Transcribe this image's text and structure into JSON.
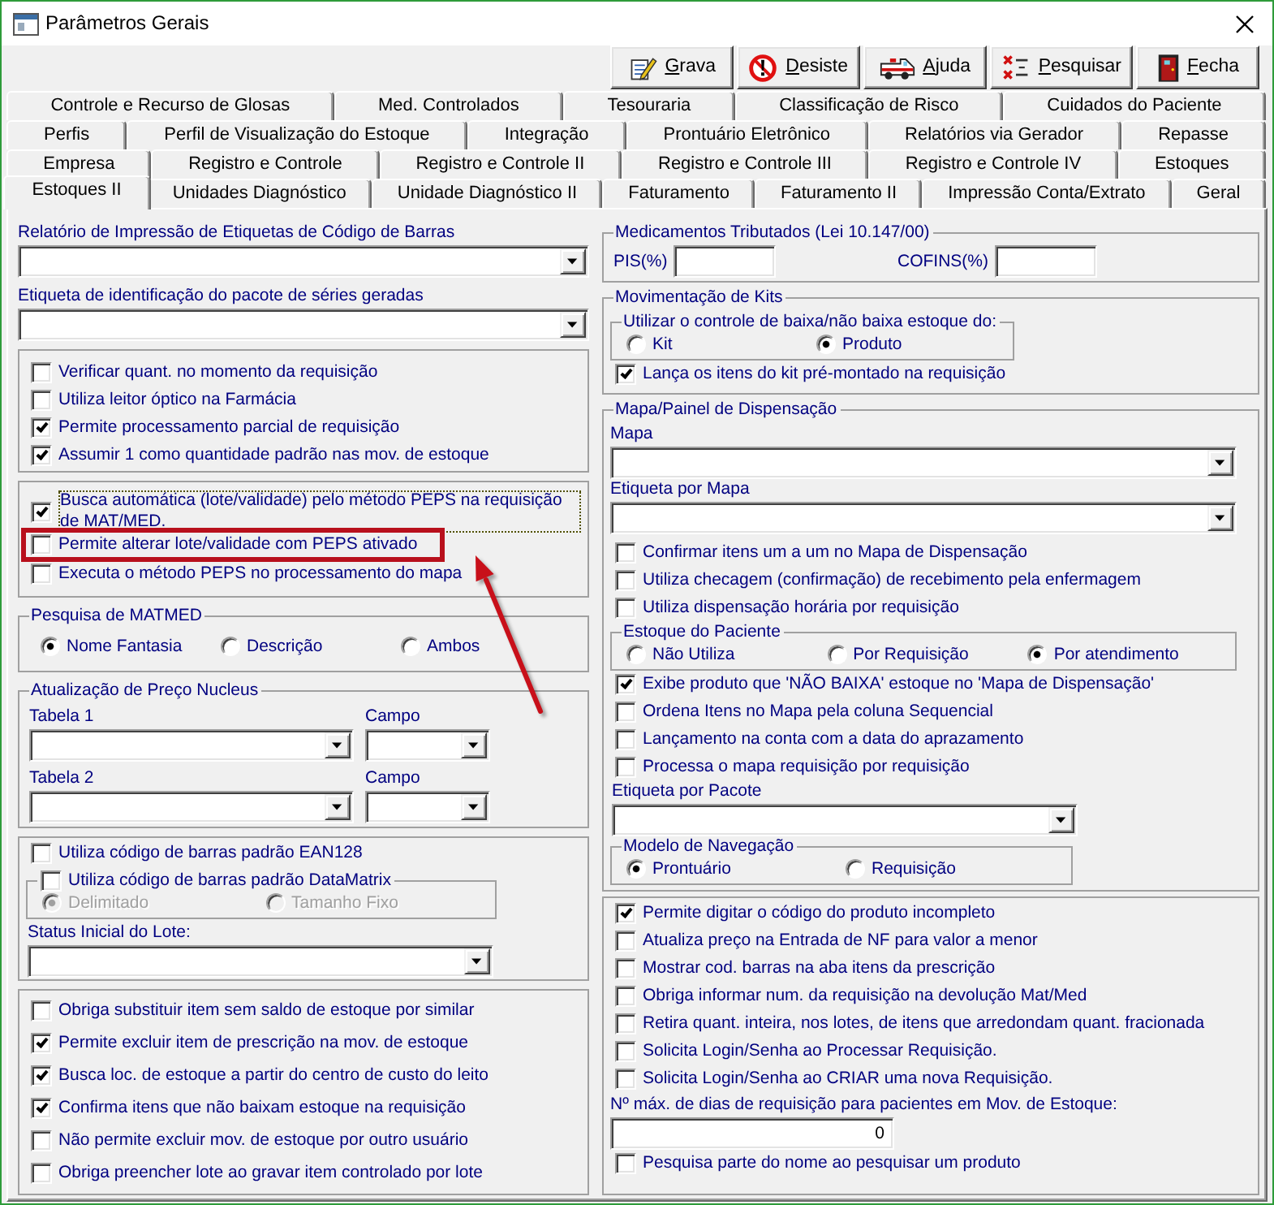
{
  "window": {
    "title": "Parâmetros Gerais"
  },
  "toolbar": [
    {
      "label": "Grava",
      "kind": "save"
    },
    {
      "label": "Desiste",
      "kind": "cancel"
    },
    {
      "label": "Ajuda",
      "kind": "help"
    },
    {
      "label": "Pesquisar",
      "kind": "search"
    },
    {
      "label": "Fecha",
      "kind": "exit"
    }
  ],
  "tab_rows": [
    [
      {
        "label": "Controle e Recurso de Glosas",
        "selected": false
      },
      {
        "label": "Med. Controlados",
        "selected": false
      },
      {
        "label": "Tesouraria",
        "selected": false
      },
      {
        "label": "Classificação de Risco",
        "selected": false
      },
      {
        "label": "Cuidados do Paciente",
        "selected": false
      }
    ],
    [
      {
        "label": "Perfis",
        "selected": false
      },
      {
        "label": "Perfil de Visualização do Estoque",
        "selected": false
      },
      {
        "label": "Integração",
        "selected": false
      },
      {
        "label": "Prontuário Eletrônico",
        "selected": false
      },
      {
        "label": "Relatórios via Gerador",
        "selected": false
      },
      {
        "label": "Repasse",
        "selected": false
      }
    ],
    [
      {
        "label": "Empresa",
        "selected": false
      },
      {
        "label": "Registro e Controle",
        "selected": false
      },
      {
        "label": "Registro e Controle II",
        "selected": false
      },
      {
        "label": "Registro e Controle III",
        "selected": false
      },
      {
        "label": "Registro e Controle IV",
        "selected": false
      },
      {
        "label": "Estoques",
        "selected": false
      }
    ],
    [
      {
        "label": "Estoques II",
        "selected": true
      },
      {
        "label": "Unidades Diagnóstico",
        "selected": false
      },
      {
        "label": "Unidade Diagnóstico II",
        "selected": false
      },
      {
        "label": "Faturamento",
        "selected": false
      },
      {
        "label": "Faturamento II",
        "selected": false
      },
      {
        "label": "Impressão Conta/Extrato",
        "selected": false
      },
      {
        "label": "Geral",
        "selected": false
      }
    ]
  ],
  "left_column": [
    {
      "kind": "combo",
      "label": "Relatório de Impressão de Etiquetas de Código de Barras"
    },
    {
      "kind": "combo",
      "label": "Etiqueta de identificação do pacote de séries geradas"
    },
    {
      "kind": "group",
      "items": [
        {
          "kind": "checkbox",
          "label": "Verificar quant. no momento da requisição",
          "checked": false
        },
        {
          "kind": "checkbox",
          "label": "Utiliza leitor óptico na Farmácia",
          "checked": false
        },
        {
          "kind": "checkbox",
          "label": "Permite processamento parcial de requisição",
          "checked": true
        },
        {
          "kind": "checkbox",
          "label": "Assumir 1 como quantidade padrão nas mov. de estoque",
          "checked": true
        }
      ]
    },
    {
      "kind": "group",
      "items": [
        {
          "kind": "checkbox",
          "label": "Busca automática (lote/validade) pelo método PEPS na requisição de MAT/MED.",
          "checked": true,
          "focused": true,
          "highlighted": false
        },
        {
          "kind": "checkbox",
          "label": "Permite alterar lote/validade com PEPS ativado",
          "checked": false,
          "focused": false,
          "highlighted": true
        },
        {
          "kind": "checkbox",
          "label": "Executa o método PEPS no processamento do mapa",
          "checked": false,
          "focused": false,
          "highlighted": false
        }
      ]
    },
    {
      "kind": "group",
      "title": "Pesquisa de MATMED",
      "items": [
        {
          "kind": "radios",
          "options": [
            {
              "label": "Nome Fantasia",
              "selected": true
            },
            {
              "label": "Descrição",
              "selected": false
            },
            {
              "label": "Ambos",
              "selected": false
            }
          ]
        }
      ]
    },
    {
      "kind": "group",
      "title": "Atualização de Preço Nucleus",
      "items": [
        {
          "kind": "combo_row",
          "fields": [
            {
              "label": "Tabela 1"
            },
            {
              "label": "Campo"
            }
          ]
        },
        {
          "kind": "combo_row",
          "fields": [
            {
              "label": "Tabela 2"
            },
            {
              "label": "Campo"
            }
          ]
        }
      ]
    },
    {
      "kind": "group",
      "items": [
        {
          "kind": "checkbox",
          "label": "Utiliza código de barras padrão EAN128",
          "checked": false
        },
        {
          "kind": "group",
          "title_checkbox": {
            "label": "Utiliza código de barras padrão DataMatrix",
            "checked": false
          },
          "items": [
            {
              "kind": "radios",
              "options": [
                {
                  "label": "Delimitado",
                  "selected": true,
                  "disabled": true
                },
                {
                  "label": "Tamanho Fixo",
                  "selected": false,
                  "disabled": true
                }
              ]
            }
          ]
        },
        {
          "kind": "combo",
          "label": "Status Inicial do Lote:"
        }
      ]
    },
    {
      "kind": "group",
      "items": [
        {
          "kind": "checkbox",
          "label": "Obriga substituir item sem saldo de estoque por similar",
          "checked": false
        },
        {
          "kind": "checkbox",
          "label": "Permite excluir item de prescrição na mov. de estoque",
          "checked": true
        },
        {
          "kind": "checkbox",
          "label": "Busca loc. de estoque a partir do centro de custo do leito",
          "checked": true
        },
        {
          "kind": "checkbox",
          "label": "Confirma itens que não baixam estoque na requisição",
          "checked": true
        },
        {
          "kind": "checkbox",
          "label": "Não permite excluir mov. de estoque por outro usuário",
          "checked": false
        },
        {
          "kind": "checkbox",
          "label": "Obriga preencher lote ao gravar item controlado por lote",
          "checked": false
        }
      ]
    }
  ],
  "right_column": [
    {
      "kind": "group",
      "title": "Medicamentos Tributados (Lei 10.147/00)",
      "items": [
        {
          "kind": "input_row",
          "fields": [
            {
              "label": "PIS(%)"
            },
            {
              "label": "COFINS(%)"
            }
          ]
        }
      ]
    },
    {
      "kind": "group",
      "title": "Movimentação de Kits",
      "items": [
        {
          "kind": "group",
          "title": "Utilizar o controle de baixa/não baixa estoque do:",
          "items": [
            {
              "kind": "radios",
              "options": [
                {
                  "label": "Kit",
                  "selected": false
                },
                {
                  "label": "Produto",
                  "selected": true
                }
              ]
            }
          ]
        },
        {
          "kind": "checkbox",
          "label": "Lança os itens do kit pré-montado na requisição",
          "checked": true
        }
      ]
    },
    {
      "kind": "group",
      "title": "Mapa/Painel de Dispensação",
      "items": [
        {
          "kind": "combo",
          "label": "Mapa"
        },
        {
          "kind": "combo",
          "label": "Etiqueta por Mapa"
        },
        {
          "kind": "checkbox",
          "label": "Confirmar itens um a um no Mapa de Dispensação",
          "checked": false
        },
        {
          "kind": "checkbox",
          "label": "Utiliza checagem (confirmação) de recebimento pela enfermagem",
          "checked": false
        },
        {
          "kind": "checkbox",
          "label": "Utiliza dispensação horária por requisição",
          "checked": false
        },
        {
          "kind": "group",
          "title": "Estoque do Paciente",
          "items": [
            {
              "kind": "radios",
              "options": [
                {
                  "label": "Não Utiliza",
                  "selected": false
                },
                {
                  "label": "Por Requisição",
                  "selected": false
                },
                {
                  "label": "Por atendimento",
                  "selected": true
                }
              ]
            }
          ]
        },
        {
          "kind": "checkbox",
          "label": "Exibe produto que 'NÃO BAIXA' estoque no 'Mapa de Dispensação'",
          "checked": true
        },
        {
          "kind": "checkbox",
          "label": "Ordena Itens no Mapa pela coluna Sequencial",
          "checked": false
        },
        {
          "kind": "checkbox",
          "label": "Lançamento na conta com a data do aprazamento",
          "checked": false
        },
        {
          "kind": "checkbox",
          "label": "Processa o mapa requisição por requisição",
          "checked": false
        },
        {
          "kind": "combo",
          "label": "Etiqueta por Pacote"
        },
        {
          "kind": "group",
          "title": "Modelo de Navegação",
          "items": [
            {
              "kind": "radios",
              "options": [
                {
                  "label": "Prontuário",
                  "selected": true
                },
                {
                  "label": "Requisição",
                  "selected": false
                }
              ]
            }
          ]
        }
      ]
    },
    {
      "kind": "group",
      "items": [
        {
          "kind": "checkbox",
          "label": "Permite digitar o código do produto incompleto",
          "checked": true
        },
        {
          "kind": "checkbox",
          "label": "Atualiza preço na Entrada de NF para valor a menor",
          "checked": false
        },
        {
          "kind": "checkbox",
          "label": "Mostrar cod. barras na aba itens da prescrição",
          "checked": false
        },
        {
          "kind": "checkbox",
          "label": "Obriga informar num. da requisição na devolução Mat/Med",
          "checked": false
        },
        {
          "kind": "checkbox",
          "label": "Retira quant. inteira, nos lotes, de itens que arredondam quant. fracionada",
          "checked": false
        },
        {
          "kind": "checkbox",
          "label": "Solicita Login/Senha ao Processar Requisição.",
          "checked": false
        },
        {
          "kind": "checkbox",
          "label": "Solicita Login/Senha ao CRIAR uma nova Requisição.",
          "checked": false
        },
        {
          "kind": "input",
          "label": "Nº máx. de dias de requisição para pacientes em Mov. de Estoque:",
          "value": "0"
        },
        {
          "kind": "checkbox",
          "label": "Pesquisa parte do nome ao pesquisar um produto",
          "checked": false
        }
      ]
    }
  ],
  "annotation_arrow": true
}
